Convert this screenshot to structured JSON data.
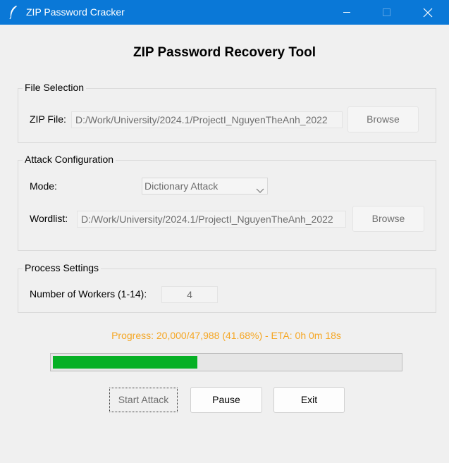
{
  "window": {
    "title": "ZIP Password Cracker",
    "icon": "feather-icon"
  },
  "heading": "ZIP Password Recovery Tool",
  "file_selection": {
    "title": "File Selection",
    "zip_label": "ZIP File:",
    "zip_value": "D:/Work/University/2024.1/ProjectI_NguyenTheAnh_2022",
    "browse_label": "Browse"
  },
  "attack_config": {
    "title": "Attack Configuration",
    "mode_label": "Mode:",
    "mode_value": "Dictionary Attack",
    "wordlist_label": "Wordlist:",
    "wordlist_value": "D:/Work/University/2024.1/ProjectI_NguyenTheAnh_2022",
    "browse_label": "Browse"
  },
  "process_settings": {
    "title": "Process Settings",
    "workers_label": "Number of Workers (1-14):",
    "workers_value": "4"
  },
  "progress": {
    "text": "Progress: 20,000/47,988 (41.68%) - ETA: 0h 0m 18s",
    "fraction": 0.4168
  },
  "buttons": {
    "start": "Start Attack",
    "pause": "Pause",
    "exit": "Exit"
  },
  "colors": {
    "titlebar": "#0a78d7",
    "progress_text": "#f5a623",
    "progress_fill": "#06b025"
  }
}
